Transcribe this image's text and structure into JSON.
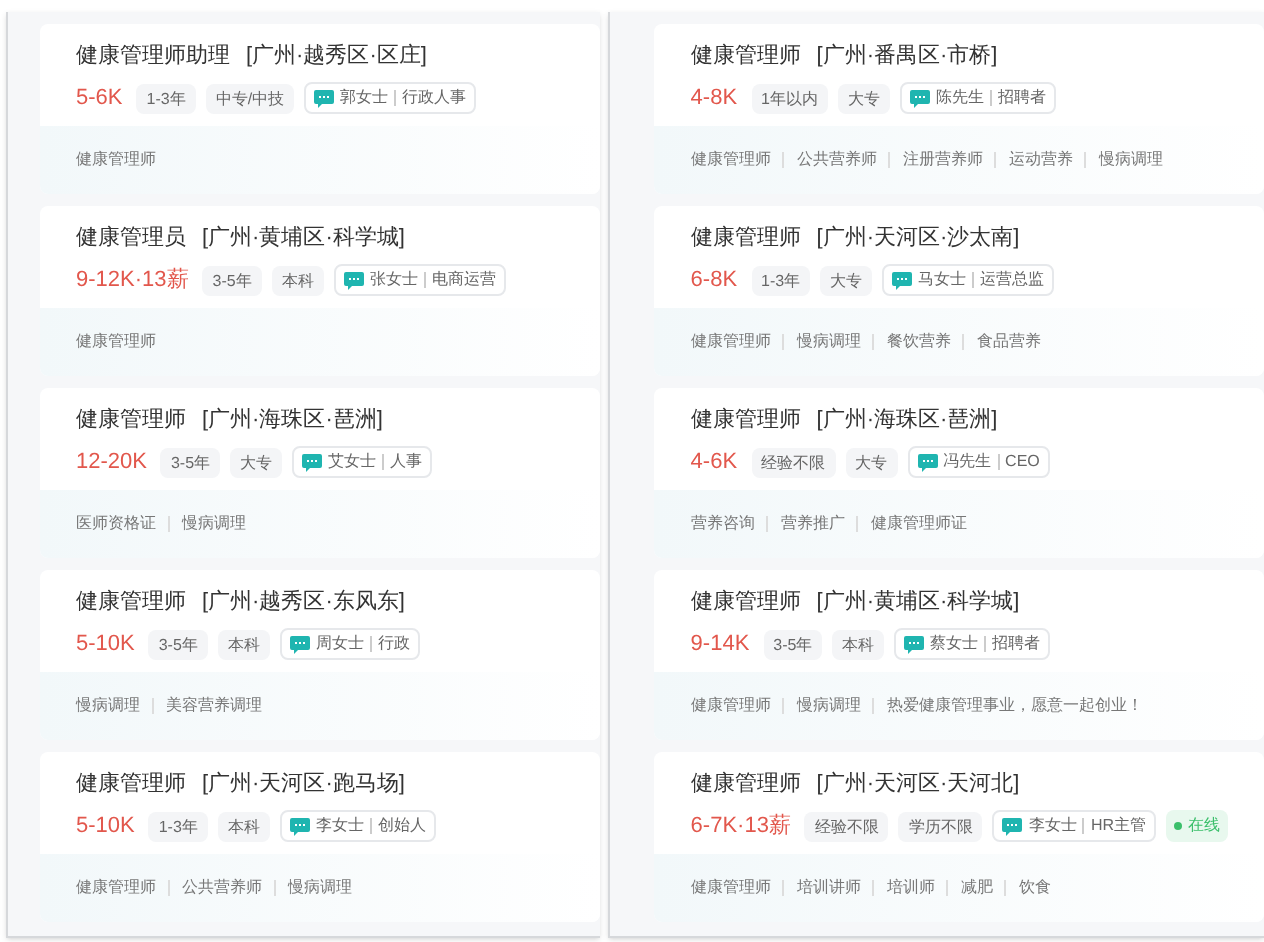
{
  "columns": [
    {
      "jobs": [
        {
          "title": "健康管理师助理",
          "location": "[广州·越秀区·区庄]",
          "salary": "5-6K",
          "tags": [
            "1-3年",
            "中专/中技"
          ],
          "recruiter": {
            "name": "郭女士",
            "role": "行政人事"
          },
          "online": false,
          "skills": [
            "健康管理师"
          ]
        },
        {
          "title": "健康管理员",
          "location": "[广州·黄埔区·科学城]",
          "salary": "9-12K·13薪",
          "tags": [
            "3-5年",
            "本科"
          ],
          "recruiter": {
            "name": "张女士",
            "role": "电商运营"
          },
          "online": false,
          "skills": [
            "健康管理师"
          ]
        },
        {
          "title": "健康管理师",
          "location": "[广州·海珠区·琶洲]",
          "salary": "12-20K",
          "tags": [
            "3-5年",
            "大专"
          ],
          "recruiter": {
            "name": "艾女士",
            "role": "人事"
          },
          "online": false,
          "skills": [
            "医师资格证",
            "慢病调理"
          ]
        },
        {
          "title": "健康管理师",
          "location": "[广州·越秀区·东风东]",
          "salary": "5-10K",
          "tags": [
            "3-5年",
            "本科"
          ],
          "recruiter": {
            "name": "周女士",
            "role": "行政"
          },
          "online": false,
          "skills": [
            "慢病调理",
            "美容营养调理"
          ]
        },
        {
          "title": "健康管理师",
          "location": "[广州·天河区·跑马场]",
          "salary": "5-10K",
          "tags": [
            "1-3年",
            "本科"
          ],
          "recruiter": {
            "name": "李女士",
            "role": "创始人"
          },
          "online": false,
          "skills": [
            "健康管理师",
            "公共营养师",
            "慢病调理"
          ]
        }
      ]
    },
    {
      "jobs": [
        {
          "title": "健康管理师",
          "location": "[广州·番禺区·市桥]",
          "salary": "4-8K",
          "tags": [
            "1年以内",
            "大专"
          ],
          "recruiter": {
            "name": "陈先生",
            "role": "招聘者"
          },
          "online": false,
          "skills": [
            "健康管理师",
            "公共营养师",
            "注册营养师",
            "运动营养",
            "慢病调理"
          ]
        },
        {
          "title": "健康管理师",
          "location": "[广州·天河区·沙太南]",
          "salary": "6-8K",
          "tags": [
            "1-3年",
            "大专"
          ],
          "recruiter": {
            "name": "马女士",
            "role": "运营总监"
          },
          "online": false,
          "skills": [
            "健康管理师",
            "慢病调理",
            "餐饮营养",
            "食品营养"
          ]
        },
        {
          "title": "健康管理师",
          "location": "[广州·海珠区·琶洲]",
          "salary": "4-6K",
          "tags": [
            "经验不限",
            "大专"
          ],
          "recruiter": {
            "name": "冯先生",
            "role": "CEO"
          },
          "online": false,
          "skills": [
            "营养咨询",
            "营养推广",
            "健康管理师证"
          ]
        },
        {
          "title": "健康管理师",
          "location": "[广州·黄埔区·科学城]",
          "salary": "9-14K",
          "tags": [
            "3-5年",
            "本科"
          ],
          "recruiter": {
            "name": "蔡女士",
            "role": "招聘者"
          },
          "online": false,
          "skills": [
            "健康管理师",
            "慢病调理",
            "热爱健康管理事业，愿意一起创业！"
          ]
        },
        {
          "title": "健康管理师",
          "location": "[广州·天河区·天河北]",
          "salary": "6-7K·13薪",
          "tags": [
            "经验不限",
            "学历不限"
          ],
          "recruiter": {
            "name": "李女士",
            "role": "HR主管"
          },
          "online": true,
          "online_label": "在线",
          "skills": [
            "健康管理师",
            "培训讲师",
            "培训师",
            "减肥",
            "饮食"
          ]
        }
      ]
    }
  ]
}
